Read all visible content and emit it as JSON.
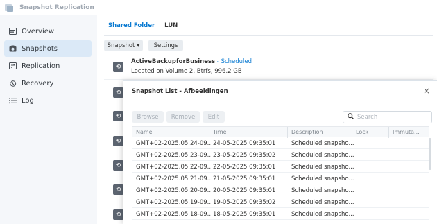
{
  "app": {
    "title": "Snapshot Replication"
  },
  "sidebar": {
    "items": [
      {
        "label": "Overview",
        "icon": "overview-icon"
      },
      {
        "label": "Snapshots",
        "icon": "camera-icon"
      },
      {
        "label": "Replication",
        "icon": "replication-icon"
      },
      {
        "label": "Recovery",
        "icon": "recovery-icon"
      },
      {
        "label": "Log",
        "icon": "list-icon"
      }
    ],
    "active": "Snapshots"
  },
  "main": {
    "tabs": [
      {
        "label": "Shared Folder"
      },
      {
        "label": "LUN"
      }
    ],
    "toolbar": {
      "snapshot_label": "Snapshot ▾",
      "settings_label": "Settings"
    },
    "folder": {
      "name": "ActiveBackupforBusiness",
      "separator": " - ",
      "status": "Scheduled",
      "location": "Located on Volume 2, Btrfs, 996.2 GB"
    }
  },
  "modal": {
    "title": "Snapshot List - Afbeeldingen",
    "close": "×",
    "buttons": {
      "browse": "Browse",
      "remove": "Remove",
      "edit": "Edit"
    },
    "search": {
      "placeholder": "Search"
    },
    "columns": [
      "Name",
      "Time",
      "Description",
      "Lock",
      "Immuta..."
    ],
    "rows": [
      {
        "name": "GMT+02-2025.05.24-09...",
        "time": "24-05-2025 09:35:01",
        "description": "Scheduled snapsho..."
      },
      {
        "name": "GMT+02-2025.05.23-09...",
        "time": "23-05-2025 09:35:02",
        "description": "Scheduled snapsho..."
      },
      {
        "name": "GMT+02-2025.05.22-09...",
        "time": "22-05-2025 09:35:01",
        "description": "Scheduled snapsho..."
      },
      {
        "name": "GMT+02-2025.05.21-09...",
        "time": "21-05-2025 09:35:01",
        "description": "Scheduled snapsho..."
      },
      {
        "name": "GMT+02-2025.05.20-09...",
        "time": "20-05-2025 09:35:01",
        "description": "Scheduled snapsho..."
      },
      {
        "name": "GMT+02-2025.05.19-09...",
        "time": "19-05-2025 09:35:02",
        "description": "Scheduled snapsho..."
      },
      {
        "name": "GMT+02-2025.05.18-09...",
        "time": "18-05-2025 09:35:01",
        "description": "Scheduled snapsho..."
      }
    ]
  },
  "colors": {
    "accent": "#0a7ad1",
    "sidebar_active": "#dbe9f7",
    "sidebar_bg": "#f5f7fa"
  }
}
